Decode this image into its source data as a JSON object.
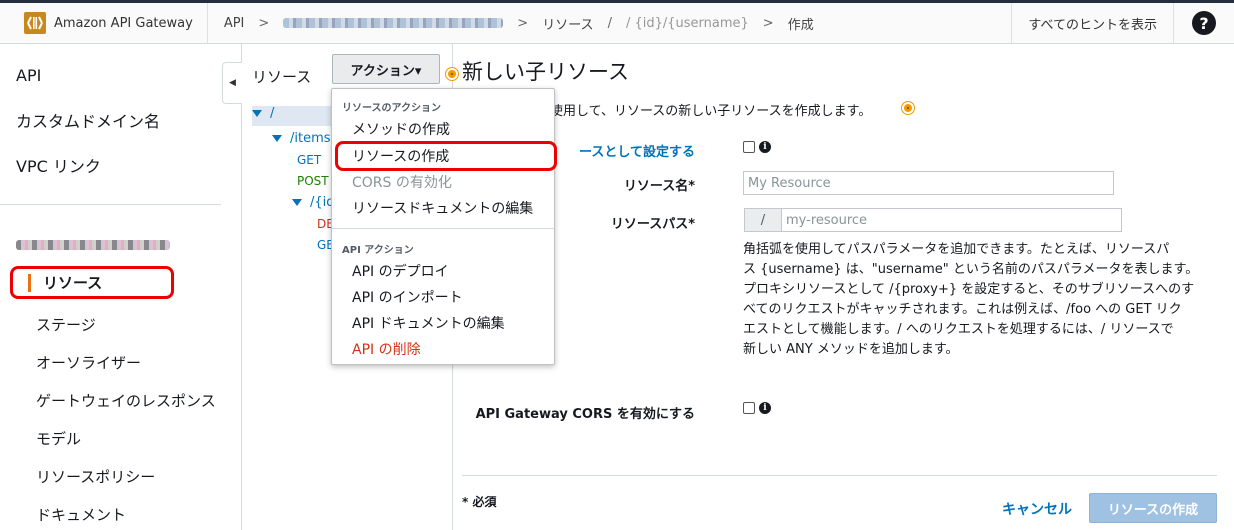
{
  "header": {
    "product": "Amazon API Gateway",
    "breadcrumb": {
      "api": "API",
      "resources": "リソース",
      "resource_path": "/ {id}/{username}",
      "create": "作成"
    },
    "show_hints": "すべてのヒントを表示",
    "help": "?"
  },
  "sidebar": {
    "top_items": [
      "API",
      "カスタムドメイン名",
      "VPC リンク"
    ],
    "sub_items": [
      {
        "label": "リソース",
        "active": true
      },
      {
        "label": "ステージ"
      },
      {
        "label": "オーソライザー"
      },
      {
        "label": "ゲートウェイのレスポンス"
      },
      {
        "label": "モデル"
      },
      {
        "label": "リソースポリシー"
      },
      {
        "label": "ドキュメント"
      }
    ]
  },
  "resources_panel": {
    "title": "リソース",
    "actions_label": "アクション▾",
    "tree": {
      "root": "/",
      "items": "/items",
      "get": "GET",
      "post": "POST",
      "id": "/{id}",
      "delete": "DELETE",
      "get2": "GET"
    }
  },
  "actions_menu": {
    "resource_header": "リソースのアクション",
    "resource_items": [
      "メソッドの作成",
      "リソースの作成",
      "CORS の有効化",
      "リソースドキュメントの編集"
    ],
    "api_header": "API アクション",
    "api_items": [
      "API のデプロイ",
      "API のインポート",
      "API ドキュメントの編集",
      "API の削除"
    ]
  },
  "form": {
    "title": "新しい子リソース",
    "description": "使用して、リソースの新しい子リソースを作成します。",
    "proxy_label_part": "ースとして設定する",
    "resource_name_label": "リソース名*",
    "resource_name_placeholder": "My Resource",
    "resource_path_label": "リソースパス*",
    "path_prefix": "/",
    "resource_path_placeholder": "my-resource",
    "help_lines": [
      "角括弧を使用してパスパラメータを追加できます。たとえば、リソースパ",
      "ス {username} は、\"username\" という名前のパスパラメータを表します。",
      "プロキシリソースとして /{proxy+} を設定すると、そのサブリソースへのす",
      "べてのリクエストがキャッチされます。これは例えば、/foo への GET リク",
      "エストとして機能します。/ へのリクエストを処理するには、/ リソースで",
      "新しい ANY メソッドを追加します。"
    ],
    "cors_label": "API Gateway CORS を有効にする",
    "required_note": "* 必須",
    "cancel": "キャンセル",
    "submit": "リソースの作成"
  },
  "colors": {
    "accent_orange": "#ec7211",
    "link_blue": "#0073bb",
    "highlight_red": "#e00000",
    "disabled_button": "#9fc2e2"
  }
}
